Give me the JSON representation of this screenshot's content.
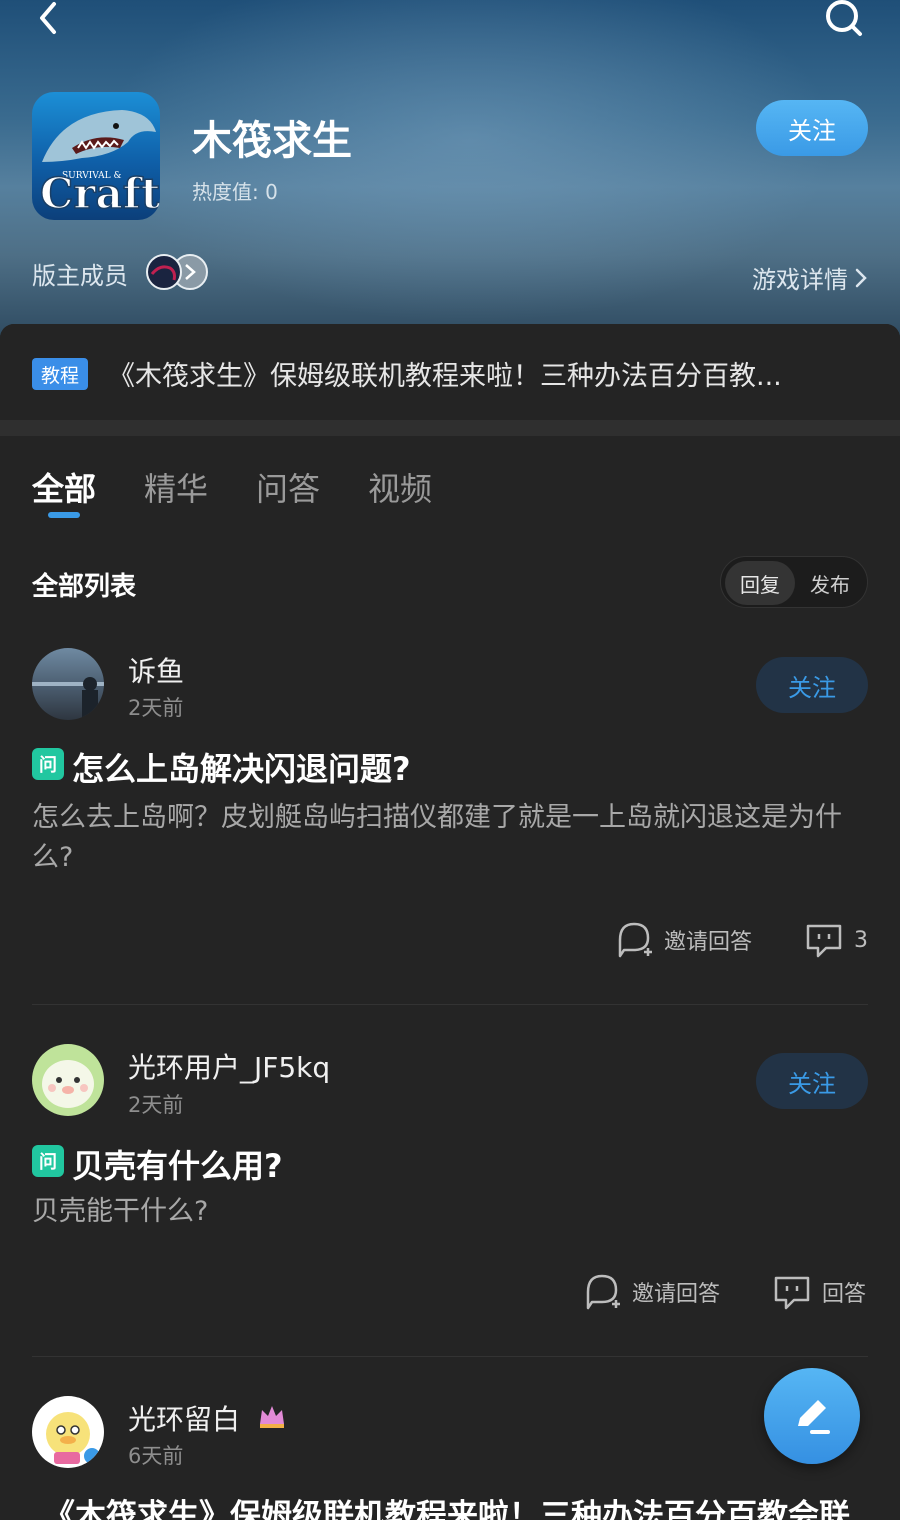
{
  "header": {
    "game_name": "木筏求生",
    "heat": "热度值: 0",
    "follow_label": "关注",
    "moderators_label": "版主成员",
    "game_detail_label": "游戏详情",
    "icon_text_small": "SURVIVAL &",
    "icon_text_large": "Craft"
  },
  "announcement": {
    "tag": "教程",
    "text": "《木筏求生》保姆级联机教程来啦！三种办法百分百教..."
  },
  "tabs": [
    {
      "label": "全部",
      "active": true
    },
    {
      "label": "精华"
    },
    {
      "label": "问答"
    },
    {
      "label": "视频"
    }
  ],
  "list": {
    "title": "全部列表",
    "sort_options": [
      "回复",
      "发布"
    ],
    "sort_active": "回复"
  },
  "posts": [
    {
      "user": "诉鱼",
      "time": "2天前",
      "follow": "关注",
      "badge": "问",
      "title": "怎么上岛解决闪退问题?",
      "body": "怎么去上岛啊？皮划艇岛屿扫描仪都建了就是一上岛就闪退这是为什么?",
      "invite": "邀请回答",
      "reply": "3"
    },
    {
      "user": "光环用户_JF5kq",
      "time": "2天前",
      "follow": "关注",
      "badge": "问",
      "title": "贝壳有什么用?",
      "body": "贝壳能干什么?",
      "invite": "邀请回答",
      "reply": "回答"
    },
    {
      "user": "光环留白",
      "time": "6天前",
      "title": "《木筏求生》保姆级联机教程来啦！三种办法百分百教会联"
    }
  ],
  "colors": {
    "accent": "#3a9ae6",
    "question_badge": "#21c7a0",
    "background": "#242424"
  }
}
